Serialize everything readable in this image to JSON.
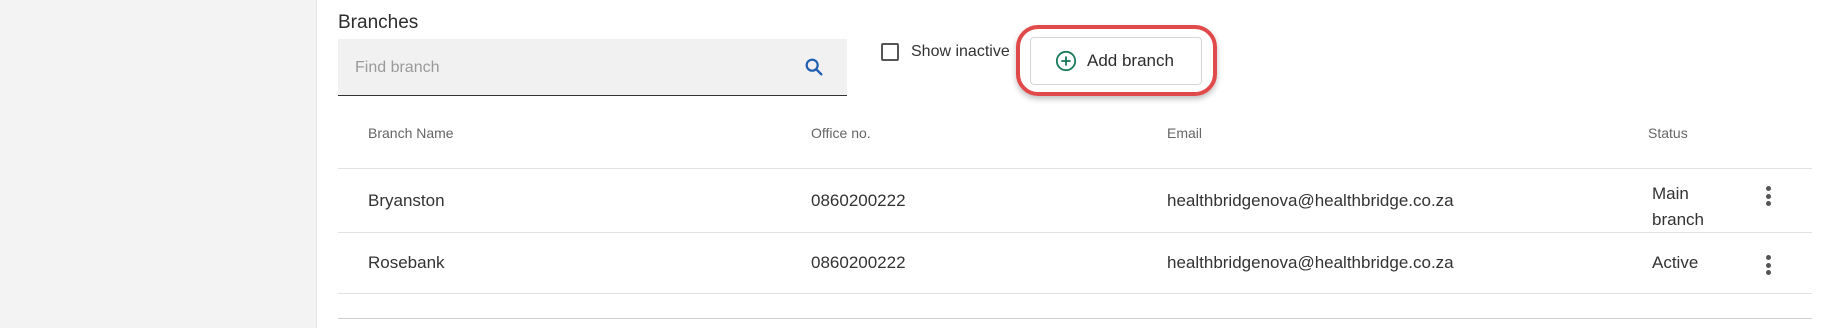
{
  "section": {
    "title": "Branches"
  },
  "search": {
    "placeholder": "Find branch",
    "value": ""
  },
  "filters": {
    "show_inactive_label": "Show inactive",
    "show_inactive_checked": false
  },
  "actions": {
    "add_branch_label": "Add branch"
  },
  "table": {
    "headers": {
      "branch_name": "Branch Name",
      "office_no": "Office no.",
      "email": "Email",
      "status": "Status"
    },
    "rows": [
      {
        "branch_name": "Bryanston",
        "office_no": "0860200222",
        "email": "healthbridgenova@healthbridge.co.za",
        "status_line1": "Main",
        "status_line2": "branch"
      },
      {
        "branch_name": "Rosebank",
        "office_no": "0860200222",
        "email": "healthbridgenova@healthbridge.co.za",
        "status": "Active"
      }
    ]
  },
  "colors": {
    "accent_green": "#1a7a5a",
    "search_icon_blue": "#1f5fb0",
    "highlight_red": "#e14a4a"
  },
  "icons": {
    "search": "search-icon",
    "add": "plus-circle-icon",
    "row_menu": "more-vertical-icon"
  }
}
